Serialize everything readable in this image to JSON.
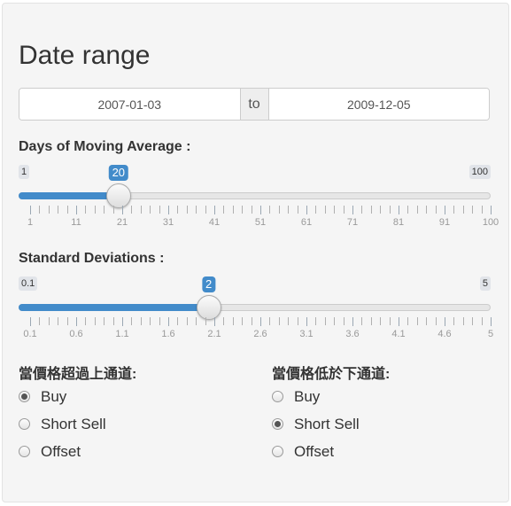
{
  "date_range": {
    "title": "Date range",
    "start": "2007-01-03",
    "separator": "to",
    "end": "2009-12-05"
  },
  "moving_average": {
    "label": "Days of Moving Average :",
    "min_label": "1",
    "max_label": "100",
    "value_label": "20",
    "min": 1,
    "max": 100,
    "value": 20,
    "ticks": [
      "1",
      "11",
      "21",
      "31",
      "41",
      "51",
      "61",
      "71",
      "81",
      "91",
      "100"
    ]
  },
  "std_dev": {
    "label": "Standard Deviations :",
    "min_label": "0.1",
    "max_label": "5",
    "value_label": "2",
    "min": 0.1,
    "max": 5,
    "value": 2,
    "ticks": [
      "0.1",
      "0.6",
      "1.1",
      "1.6",
      "2.1",
      "2.6",
      "3.1",
      "3.6",
      "4.1",
      "4.6",
      "5"
    ]
  },
  "upper_channel": {
    "title": "當價格超過上通道:",
    "options": [
      "Buy",
      "Short Sell",
      "Offset"
    ],
    "selected": "Buy"
  },
  "lower_channel": {
    "title": "當價格低於下通道:",
    "options": [
      "Buy",
      "Short Sell",
      "Offset"
    ],
    "selected": "Short Sell"
  },
  "colors": {
    "accent": "#428bca",
    "panel_bg": "#f5f5f5"
  }
}
